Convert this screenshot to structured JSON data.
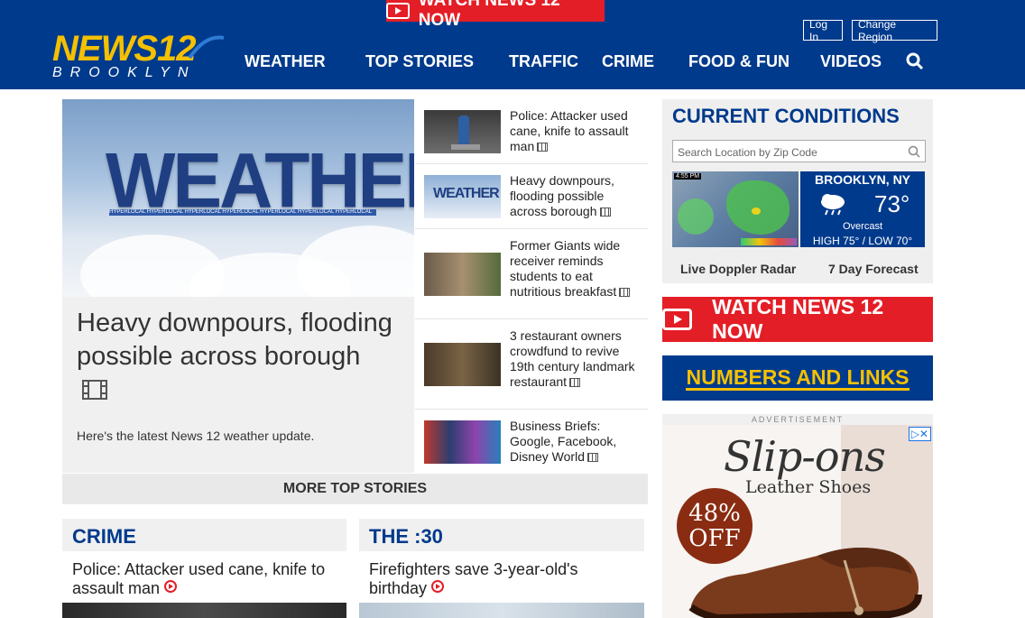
{
  "header": {
    "watch_banner": "WATCH NEWS 12 NOW",
    "logo_main": "NEWS12",
    "logo_region": "BROOKLYN",
    "login": "Log In",
    "change_region": "Change Region",
    "nav": [
      "WEATHER",
      "TOP STORIES",
      "TRAFFIC",
      "CRIME",
      "FOOD & FUN",
      "VIDEOS"
    ],
    "colors": {
      "primary": "#003a8c",
      "accent": "#e41e26",
      "yellow": "#f5c000"
    }
  },
  "hero": {
    "image_text": "WEATHER",
    "image_strip": "HYPERLOCAL HYPERLOCAL HYPERLOCAL HYPERLOCAL HYPERLOCAL HYPERLOCAL HYPERLOCAL",
    "title": "Heavy downpours, flooding possible across borough",
    "subtitle": "Here's the latest News 12 weather update."
  },
  "stories": [
    {
      "title": "Police: Attacker used cane, knife to assault man"
    },
    {
      "title": "Heavy downpours, flooding possible across borough",
      "thumb_text": "WEATHER"
    },
    {
      "title": "Former Giants wide receiver reminds students to eat nutritious breakfast"
    },
    {
      "title": "3 restaurant owners crowdfund to revive 19th century landmark restaurant"
    },
    {
      "title": "Business Briefs: Google, Facebook, Disney World"
    }
  ],
  "more_button": "MORE TOP STORIES",
  "cards": [
    {
      "category": "CRIME",
      "headline": "Police: Attacker used cane, knife to assault man"
    },
    {
      "category": "THE :30",
      "headline": "Firefighters save 3-year-old's birthday"
    }
  ],
  "conditions": {
    "title": "CURRENT CONDITIONS",
    "search_placeholder": "Search Location by Zip Code",
    "radar_time": "4:55 PM",
    "location": "BROOKLYN, NY",
    "temp": "73°",
    "condition": "Overcast",
    "hilo": "HIGH 75° / LOW 70°",
    "link_radar": "Live Doppler Radar",
    "link_forecast": "7 Day Forecast"
  },
  "watch_big": "WATCH NEWS 12 NOW",
  "numbers": "NUMBERS AND LINKS",
  "ad": {
    "label": "ADVERTISEMENT",
    "title": "Slip-ons",
    "subtitle": "Leather Shoes",
    "pct": "48%",
    "off": "OFF"
  }
}
